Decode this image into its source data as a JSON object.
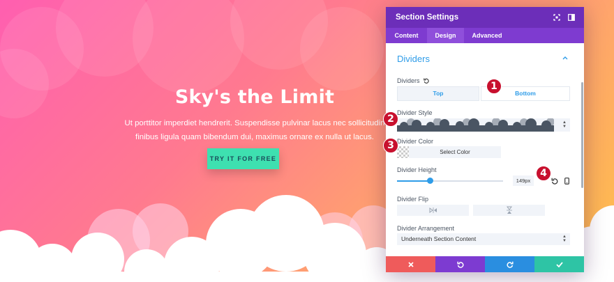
{
  "hero": {
    "title": "Sky's the Limit",
    "text_line1": "Ut porttitor imperdiet hendrerit. Suspendisse pulvinar lacus nec sollicitudin",
    "text_line2": "finibus ligula quam bibendum dui, maximus ornare ex nulla ut lacus.",
    "button": "TRY IT FOR FREE"
  },
  "panel": {
    "title": "Section Settings",
    "header_icons": [
      "fullscreen-icon",
      "split-view-icon"
    ],
    "tabs": [
      {
        "label": "Content",
        "active": false
      },
      {
        "label": "Design",
        "active": true
      },
      {
        "label": "Advanced",
        "active": false
      }
    ],
    "section_title": "Dividers",
    "dividers": {
      "label": "Dividers",
      "options": [
        "Top",
        "Bottom"
      ],
      "selected": "Bottom"
    },
    "divider_style": {
      "label": "Divider Style"
    },
    "divider_color": {
      "label": "Divider Color",
      "button": "Select Color"
    },
    "divider_height": {
      "label": "Divider Height",
      "value": "149px",
      "slider_fraction": 0.31
    },
    "divider_flip": {
      "label": "Divider Flip",
      "icons": [
        "flip-horizontal-icon",
        "flip-vertical-icon"
      ]
    },
    "divider_arrangement": {
      "label": "Divider Arrangement",
      "value": "Underneath Section Content"
    },
    "footer_buttons": [
      {
        "icon": "close-icon",
        "color": "#ef5b5b"
      },
      {
        "icon": "undo-icon",
        "color": "#7d3bd1"
      },
      {
        "icon": "redo-icon",
        "color": "#2a8ee0"
      },
      {
        "icon": "check-icon",
        "color": "#2ec4a5"
      }
    ]
  },
  "markers": [
    "1",
    "2",
    "3",
    "4"
  ],
  "colors": {
    "header": "#6c2eb9",
    "tabs": "#7e3bd0",
    "accent": "#2e9ce8",
    "hero_button": "#3ee0b0",
    "marker": "#c8102e"
  }
}
